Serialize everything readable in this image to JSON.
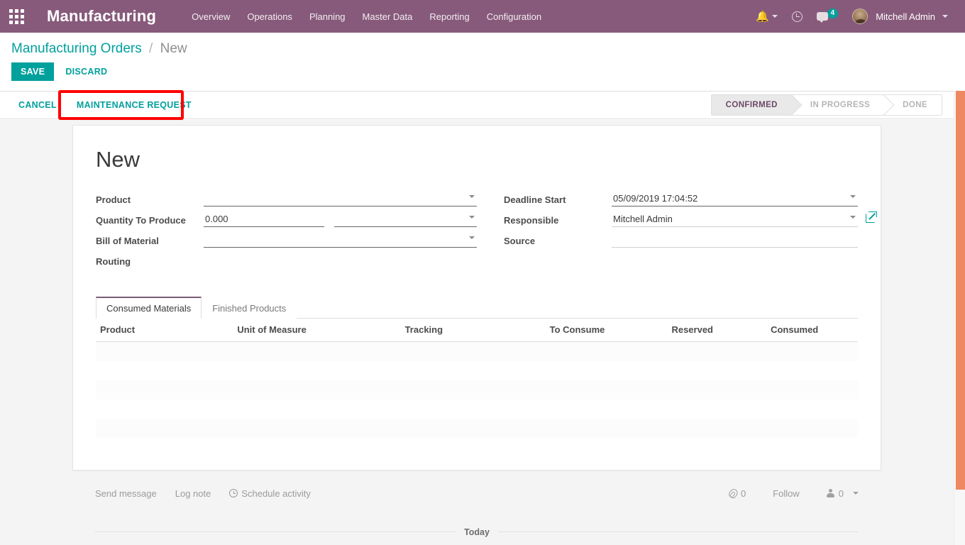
{
  "navbar": {
    "apps_icon": "apps-grid-icon",
    "brand": "Manufacturing",
    "menu": [
      {
        "label": "Overview"
      },
      {
        "label": "Operations"
      },
      {
        "label": "Planning"
      },
      {
        "label": "Master Data"
      },
      {
        "label": "Reporting"
      },
      {
        "label": "Configuration"
      }
    ],
    "right": {
      "bell_icon": "bell-icon",
      "clock_icon": "clock-icon",
      "chat_icon": "chat-bubble-icon",
      "chat_badge": "4",
      "avatar_icon": "user-avatar",
      "user_name": "Mitchell Admin"
    }
  },
  "control_panel": {
    "breadcrumb": {
      "root": "Manufacturing Orders",
      "separator": "/",
      "current": "New"
    },
    "save_label": "SAVE",
    "discard_label": "DISCARD"
  },
  "statusbar_row": {
    "cancel_label": "CANCEL",
    "maintenance_request_label": "MAINTENANCE REQUEST",
    "highlight_color": "#FF0000",
    "stages": [
      {
        "label": "CONFIRMED",
        "active": true
      },
      {
        "label": "IN PROGRESS",
        "active": false
      },
      {
        "label": "DONE",
        "active": false
      }
    ]
  },
  "form": {
    "record_title": "New",
    "left_fields": [
      {
        "label": "Product",
        "value": "",
        "placeholder": "",
        "has_caret": true,
        "dark_line": true
      },
      {
        "label": "Quantity To Produce",
        "value": "0.000",
        "placeholder": "",
        "uom_value": "",
        "has_caret": true,
        "dark_line": true
      },
      {
        "label": "Bill of Material",
        "value": "",
        "placeholder": "",
        "has_caret": true,
        "dark_line": true
      },
      {
        "label": "Routing",
        "value": "",
        "placeholder": "",
        "has_caret": false,
        "dark_line": false
      }
    ],
    "right_fields": [
      {
        "label": "Deadline Start",
        "value": "05/09/2019 17:04:52",
        "placeholder": "",
        "has_caret": true,
        "dark_line": true
      },
      {
        "label": "Responsible",
        "value": "Mitchell Admin",
        "placeholder": "",
        "has_caret": true,
        "dark_line": false,
        "ext_link": true
      },
      {
        "label": "Source",
        "value": "",
        "placeholder": "",
        "has_caret": false,
        "dark_line": false
      }
    ]
  },
  "notebook": {
    "tabs": [
      {
        "label": "Consumed Materials",
        "active": true
      },
      {
        "label": "Finished Products",
        "active": false
      }
    ],
    "columns": [
      {
        "label": "Product",
        "align": "left"
      },
      {
        "label": "Unit of Measure",
        "align": "left"
      },
      {
        "label": "Tracking",
        "align": "left"
      },
      {
        "label": "To Consume",
        "align": "left"
      },
      {
        "label": "Reserved",
        "align": "left"
      },
      {
        "label": "Consumed",
        "align": "left"
      }
    ],
    "rows": []
  },
  "chatter": {
    "send_message": "Send message",
    "log_note": "Log note",
    "schedule_activity": "Schedule activity",
    "schedule_icon": "clock-icon",
    "attachment_icon": "paperclip-icon",
    "attachment_count": "0",
    "follow_label": "Follow",
    "followers_icon": "person-icon",
    "followers_count": "0",
    "today_label": "Today"
  },
  "scrollbar": {
    "thumb_color": "#ED8862"
  }
}
